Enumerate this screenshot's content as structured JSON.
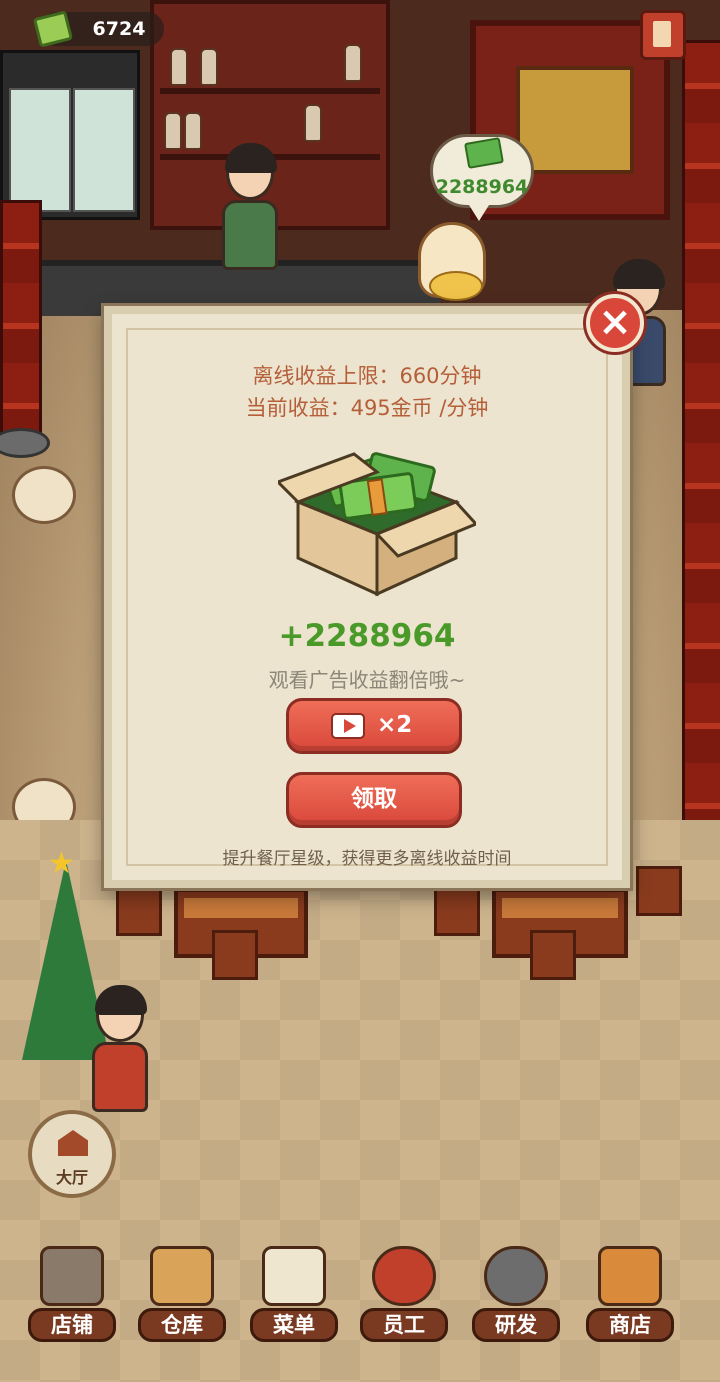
{
  "hud": {
    "coin_balance": "6724",
    "coin_icon": "cash-icon",
    "book_icon": "recipe-book-icon"
  },
  "cashier_bubble": {
    "amount": "2288964"
  },
  "offline_dialog": {
    "limit_text": "离线收益上限：660分钟",
    "rate_text": "当前收益：495金币 /分钟",
    "reward_amount": "+2288964",
    "ad_hint": "观看广告收益翻倍哦~",
    "ad_button_label": "×2",
    "claim_button_label": "领取",
    "footer_note": "提升餐厅星级，获得更多离线收益时间",
    "close_icon": "close-icon"
  },
  "lobby_button": {
    "label": "大厅"
  },
  "bottom_nav": [
    {
      "label": "店铺",
      "icon": "shop-front-icon",
      "color": "#8a7a6a"
    },
    {
      "label": "仓库",
      "icon": "warehouse-boxes-icon",
      "color": "#d9a45a"
    },
    {
      "label": "菜单",
      "icon": "menu-clipboard-icon",
      "color": "#efe6cf"
    },
    {
      "label": "员工",
      "icon": "staff-chef-icon",
      "color": "#c0402c"
    },
    {
      "label": "研发",
      "icon": "wok-icon",
      "color": "#6d6d6d"
    },
    {
      "label": "商店",
      "icon": "store-icon",
      "color": "#d98a3a"
    }
  ]
}
